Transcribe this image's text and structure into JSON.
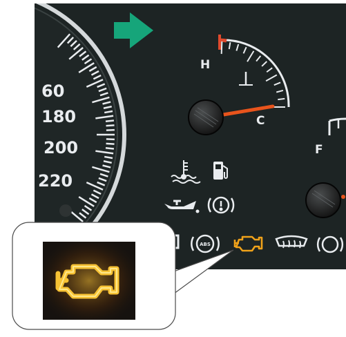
{
  "colors": {
    "dashboard": "#1d2424",
    "needle": "#e8541c",
    "arrow": "#16a57a",
    "warning_amber": "#f0a21a",
    "tick": "#e9ecef"
  },
  "speedometer": {
    "labels": [
      "60",
      "180",
      "200",
      "220"
    ]
  },
  "temperature_gauge": {
    "hot_label": "H",
    "cold_label": "C"
  },
  "fuel_gauge": {
    "full_label": "F"
  },
  "indicator_lights": [
    {
      "icon": "coolant-temperature-icon"
    },
    {
      "icon": "fuel-pump-icon"
    },
    {
      "icon": "oil-pressure-icon"
    },
    {
      "icon": "brake-warning-icon"
    },
    {
      "icon": "door-ajar-icon"
    },
    {
      "icon": "abs-icon",
      "text": "ABS"
    },
    {
      "icon": "check-engine-icon",
      "lit": true
    },
    {
      "icon": "rear-defrost-icon"
    },
    {
      "icon": "parking-brake-icon"
    }
  ],
  "turn_signal": {
    "icon": "right-turn-arrow-icon",
    "direction": "right"
  },
  "callout": {
    "icon": "check-engine-icon",
    "state": "illuminated"
  }
}
